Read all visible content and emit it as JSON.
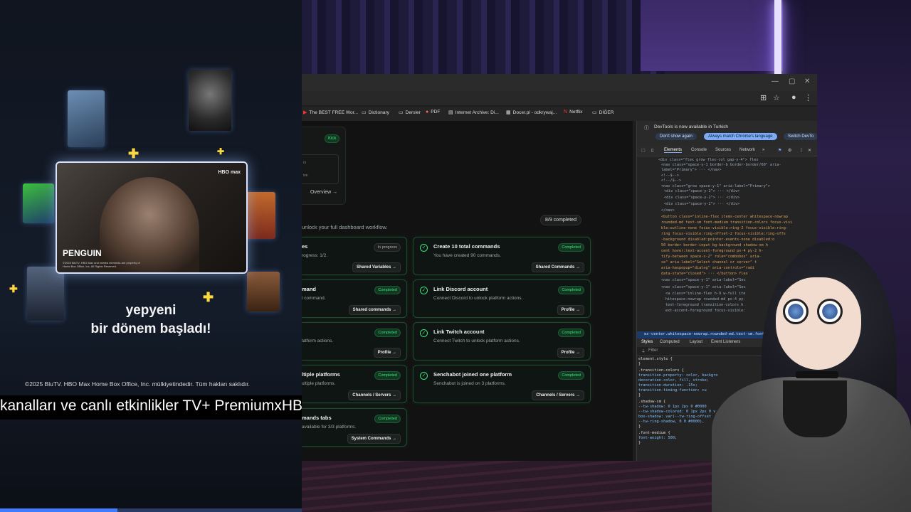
{
  "promo": {
    "tv_title": "PENGUIN",
    "tv_logo": "HBO max",
    "tv_copyright": "©2025 BluTV. HBO Max and related elements are property of Home Box Office, Inc. All Rights Reserved.",
    "headline_line1": "yepyeni",
    "headline_line2": "bir dönem başladı!",
    "copyright": "©2025 BluTV. HBO Max Home Box Office, Inc. mülkiyetindedir. Tüm hakları saklıdır.",
    "ticker": "kanalları ve canlı etkinlikler TV+ PremiumxHBO",
    "progress": 0.39
  },
  "bookmarks": [
    {
      "icon": "youtube-icon",
      "label": "The BEST FREE Wor..."
    },
    {
      "icon": "folder-icon",
      "label": "Dictionary"
    },
    {
      "icon": "folder-icon",
      "label": "Dersler"
    },
    {
      "icon": "pdf-icon",
      "label": "PDF"
    },
    {
      "icon": "archive-icon",
      "label": "Internet Archive: Di..."
    },
    {
      "icon": "docer-icon",
      "label": "Docer.pl - odkrywaj..."
    },
    {
      "icon": "netflix-icon",
      "label": "Netflix"
    },
    {
      "icon": "folder-icon",
      "label": "DİĞER"
    }
  ],
  "dashboard": {
    "kick_badge": "Kick",
    "kick_lines": [
      "rs",
      "ive"
    ],
    "overview_link": "Overview →",
    "completed_count": "8/9 completed",
    "unlock_text": "unlock your full dashboard workflow.",
    "cards_left": [
      {
        "title": "es",
        "desc": "rogress: 1/2.",
        "badge": "In progress",
        "button": "Shared Variables →"
      },
      {
        "title": "mand",
        "desc": "l command.",
        "badge": "Completed",
        "button": "Shared commands →"
      },
      {
        "title": "",
        "desc": "latform actions.",
        "badge": "Completed",
        "button": "Profile →"
      },
      {
        "title": "ltiple platforms",
        "desc": "ultiple platforms.",
        "badge": "Completed",
        "button": "Channels / Servers →"
      },
      {
        "title": "mands tabs",
        "desc": "available for 3/3 platforms.",
        "badge": "Completed",
        "button": "System Commands →"
      }
    ],
    "cards_right": [
      {
        "title": "Create 10 total commands",
        "desc": "You have created 90 commands.",
        "badge": "Completed",
        "button": "Shared Commands →"
      },
      {
        "title": "Link Discord account",
        "desc": "Connect Discord to unlock platform actions.",
        "badge": "Completed",
        "button": "Profile →"
      },
      {
        "title": "Link Twitch account",
        "desc": "Connect Twitch to unlock platform actions.",
        "badge": "Completed",
        "button": "Profile →"
      },
      {
        "title": "Senchabot joined one platform",
        "desc": "Senchabot is joined on 3 platforms.",
        "badge": "Completed",
        "button": "Channels / Servers →"
      }
    ]
  },
  "devtools": {
    "notice": "DevTools is now available in Turkish",
    "btn_dont_show": "Don't show again",
    "btn_match": "Always match Chrome's language",
    "btn_switch": "Switch DevTo",
    "tabs": [
      "Elements",
      "Console",
      "Sources",
      "Network",
      "»"
    ],
    "code_lines": [
      "<div class=\"flex grow flex-col gap-y-4\"> flex",
      "  <nav class=\"space-y-1 border-b border-border/60\" aria-",
      "  label=\"Primary\"> ··· </nav>",
      "  <!--$-->",
      "  <!--/$-->",
      "  <nav class=\"grow space-y-1\" aria-label=\"Primary\">",
      "    <div class=\"space-y-2\"> ··· </div>",
      "    <div class=\"space-y-2\"> ··· </div>",
      "    <div class=\"space-y-2\"> ··· </div>",
      "  </nav>",
      "  <button class=\"inline-flex items-center whitespace-nowrap",
      "  rounded-md text-sm font-medium transition-colors focus-visi",
      "  ble:outline-none focus-visible:ring-2 focus-visible:ring-",
      "  ring focus-visible:ring-offset-2 focus-visible:ring-offs",
      "  -background disabled:pointer-events-none disabled:o",
      "  50 border border-input bg-background shadow-sm h",
      "  cent hover:text-accent-foreground px-4 py-2 h-",
      "  tify-between space-x-2\" role=\"combobox\" aria-",
      "  se\" aria-label=\"Select channel or server\" t",
      "  aria-haspopup=\"dialog\" aria-controls=\"radi",
      "  data-state=\"closed\"> ··· </button> flex",
      "  <nav class=\"space-y-1\" aria-label=\"Sec",
      "  <nav class=\"space-y-1\" aria-label=\"Sec",
      "    <a class=\"inline-flex h-9 w-full ite",
      "    hitespace-nowrap rounded-md px-4 py-",
      "    text-foreground transition-colors h",
      "    ext-accent-foreground focus-visible:"
    ],
    "selected_path": "es-center.whitespace-nowrap.rounded-md.text-sm.font",
    "subtabs": [
      "Styles",
      "Computed",
      "Layout",
      "Event Listeners"
    ],
    "filter_placeholder": "Filter",
    "style_lines": [
      "element.style {",
      "}",
      ".transition-colors {",
      "  transition-property: color, backgro",
      "    decoration-color, fill, stroke;",
      "  transition-duration: .15s;",
      "  transition-timing-function: cu",
      "}",
      ".shadow-sm {",
      "  --tw-shadow: 0 1px 2px 0 #0000",
      "  --tw-shadow-colored: 0 1px 2px 0 v",
      "  box-shadow: var(--tw-ring-offset",
      "    --tw-ring-shadow, 0 0 #0000),",
      "}",
      ".font-medium {",
      "  font-weight: 500;",
      "}"
    ]
  },
  "colors": {
    "accent_green": "#3ee07a",
    "devtools_blue": "#1b3b6a",
    "badge_bg": "#123822"
  }
}
